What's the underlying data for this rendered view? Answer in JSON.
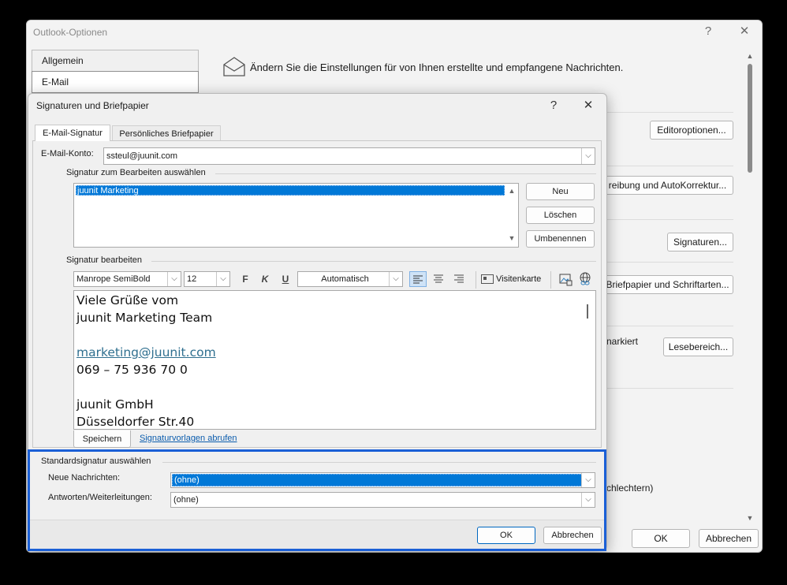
{
  "outer": {
    "title": "Outlook-Optionen",
    "help_glyph": "?",
    "close_glyph": "✕",
    "nav": [
      "Allgemein",
      "E-Mail"
    ],
    "header_text": "Ändern Sie die Einstellungen für von Ihnen erstellte und empfangene Nachrichten.",
    "buttons": {
      "editor": "Editoroptionen...",
      "spelling": "reibung und AutoKorrektur...",
      "signatures": "Signaturen...",
      "stationery": "Briefpapier und Schriftarten...",
      "reading": "Lesebereich..."
    },
    "partial_texts": {
      "markiert": "narkiert",
      "schlechtern": "chlechtern)"
    },
    "ok": "OK",
    "cancel": "Abbrechen"
  },
  "dialog": {
    "title": "Signaturen und Briefpapier",
    "help_glyph": "?",
    "close_glyph": "✕",
    "tabs": [
      "E-Mail-Signatur",
      "Persönliches Briefpapier"
    ],
    "account_label": "E-Mail-Konto:",
    "account_value": "ssteul@juunit.com",
    "select_sig_label": "Signatur zum Bearbeiten auswählen",
    "signatures": [
      "juunit Marketing"
    ],
    "btn_new": "Neu",
    "btn_delete": "Löschen",
    "btn_rename": "Umbenennen",
    "edit_sig_label": "Signatur bearbeiten",
    "font_name": "Manrope SemiBold",
    "font_size": "12",
    "bold": "F",
    "italic": "K",
    "underline": "U",
    "color": "Automatisch",
    "business_card": "Visitenkarte",
    "editor_lines": [
      "Viele Grüße vom",
      "juunit Marketing Team",
      "",
      "marketing@juunit.com",
      "069 – 75 936 70 0",
      "",
      "juunit GmbH",
      "Düsseldorfer Str.40"
    ],
    "btn_save": "Speichern",
    "templates_link": "Signaturvorlagen abrufen",
    "default_label": "Standardsignatur auswählen",
    "new_messages_label": "Neue Nachrichten:",
    "new_messages_value": "(ohne)",
    "replies_label": "Antworten/Weiterleitungen:",
    "replies_value": "(ohne)",
    "ok": "OK",
    "cancel": "Abbrechen"
  },
  "colors": {
    "accent": "#0a62d0",
    "highlight_border": "#1a5fd6",
    "selection": "#0078d7",
    "link": "#0b5cad"
  }
}
